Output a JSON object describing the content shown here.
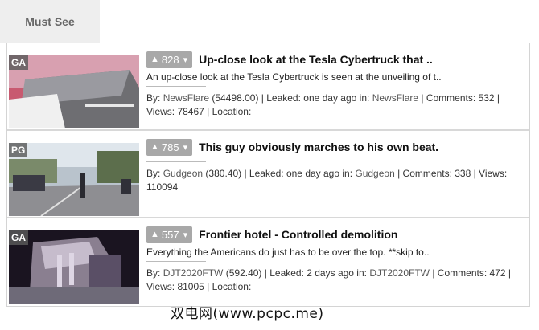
{
  "tab": {
    "label": "Must See"
  },
  "items": [
    {
      "rating": "GA",
      "votes": "828",
      "title": "Up-close look at the Tesla Cybertruck that ..",
      "description": "An up-close look at the Tesla Cybertruck is seen at the unveiling of t..",
      "by_label": "By:",
      "author": "NewsFlare",
      "author_score": "(54498.00)",
      "leaked": "| Leaked: one day ago in:",
      "source": "NewsFlare",
      "comments": "| Comments: 532 |",
      "views": "Views: 78467 | Location:"
    },
    {
      "rating": "PG",
      "votes": "785",
      "title": "This guy obviously marches to his own beat.",
      "description": "",
      "by_label": "By:",
      "author": "Gudgeon",
      "author_score": "(380.40)",
      "leaked": "| Leaked: one day ago in:",
      "source": "Gudgeon",
      "comments": "| Comments: 338 | Views:",
      "views": "110094"
    },
    {
      "rating": "GA",
      "votes": "557",
      "title": "Frontier hotel - Controlled demolition",
      "description": "Everything the Americans do just has to be over the top. **skip to..",
      "by_label": "By:",
      "author": "DJT2020FTW",
      "author_score": "(592.40)",
      "leaked": "| Leaked: 2 days ago in:",
      "source": "DJT2020FTW",
      "comments": "| Comments: 472 |",
      "views": "Views: 81005 | Location:"
    }
  ],
  "watermark": "双电网(www.pcpc.me)"
}
